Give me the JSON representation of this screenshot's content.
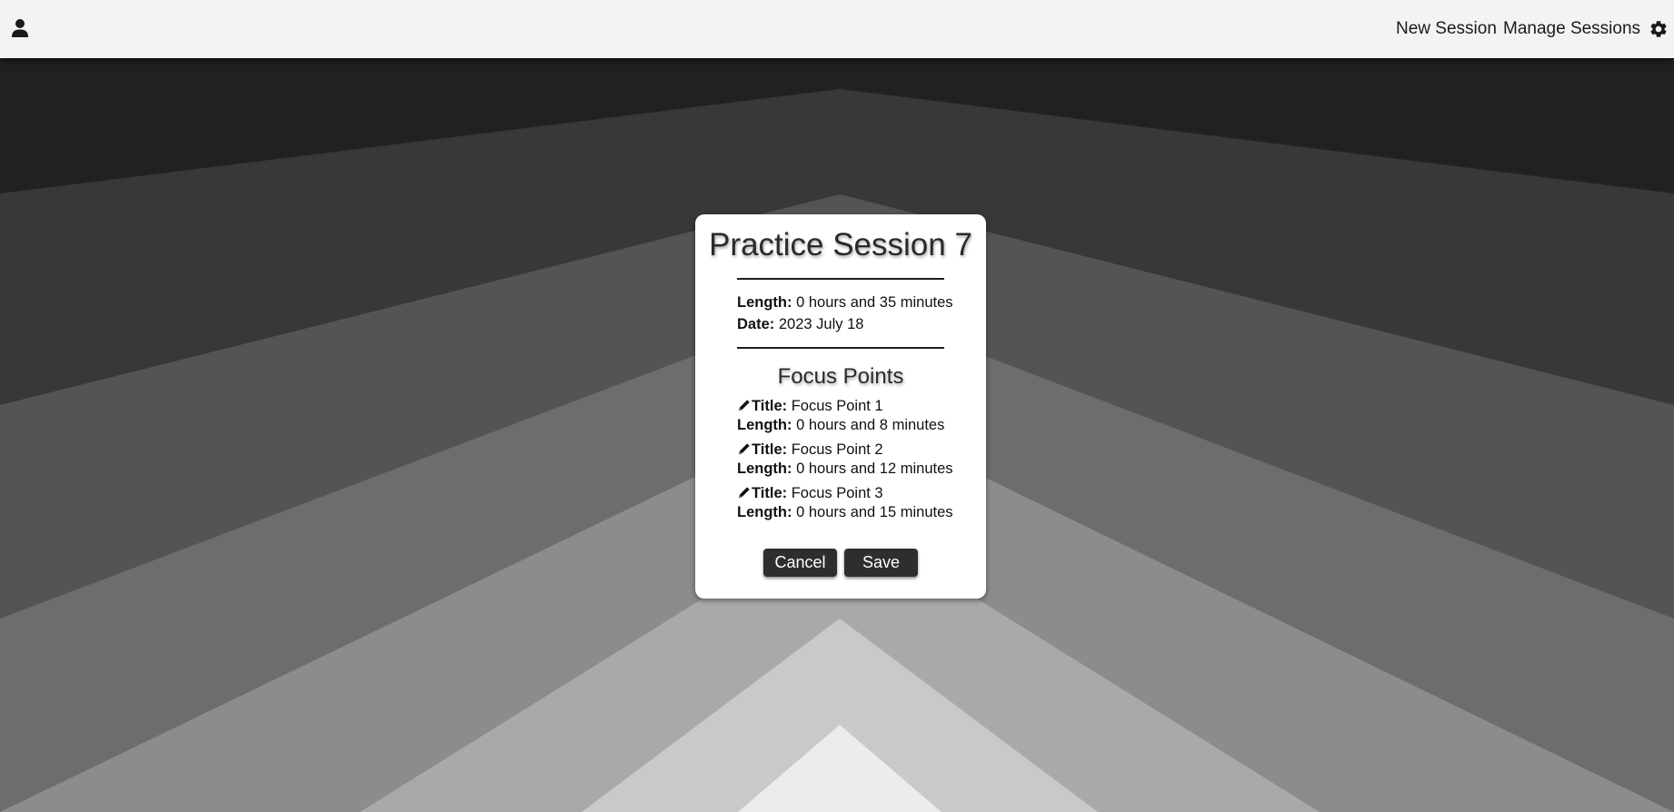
{
  "nav": {
    "user_icon": "user-icon",
    "links": [
      "New Session",
      "Manage Sessions"
    ],
    "settings_icon": "gear-icon"
  },
  "session": {
    "title": "Practice Session 7",
    "length_label": "Length:",
    "length_value": "0 hours and 35 minutes",
    "date_label": "Date:",
    "date_value": "2023 July 18"
  },
  "focus_points": {
    "heading": "Focus Points",
    "items": [
      {
        "title_label": "Title:",
        "title": "Focus Point 1",
        "length_label": "Length:",
        "length": "0 hours and 8 minutes"
      },
      {
        "title_label": "Title:",
        "title": "Focus Point 2",
        "length_label": "Length:",
        "length": "0 hours and 12 minutes"
      },
      {
        "title_label": "Title:",
        "title": "Focus Point 3",
        "length_label": "Length:",
        "length": "0 hours and 15 minutes"
      }
    ],
    "edit_icon": "pencil-icon"
  },
  "actions": {
    "cancel_label": "Cancel",
    "save_label": "Save"
  },
  "colors": {
    "topbar_bg": "#f3f3f3",
    "button_bg": "#2e2e2e",
    "card_bg": "#ffffff",
    "background_darkest": "#212121",
    "background_lightest": "#ececec"
  }
}
